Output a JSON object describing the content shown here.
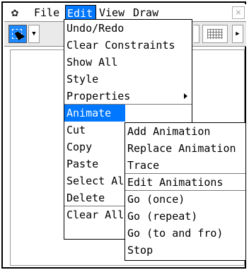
{
  "menubar": {
    "items": [
      {
        "label": "File"
      },
      {
        "label": "Edit"
      },
      {
        "label": "View"
      },
      {
        "label": "Draw"
      }
    ],
    "close": "×"
  },
  "edit_menu": {
    "items": [
      {
        "label": "Undo/Redo"
      },
      {
        "label": "Clear Constraints"
      },
      {
        "label": "Show All"
      },
      {
        "label": "Style"
      },
      {
        "label": "Properties"
      },
      {
        "label": "Animate"
      },
      {
        "label": "Cut"
      },
      {
        "label": "Copy"
      },
      {
        "label": "Paste"
      },
      {
        "label": "Select All"
      },
      {
        "label": "Delete"
      },
      {
        "label": "Clear All"
      }
    ]
  },
  "animate_menu": {
    "items": [
      {
        "label": "Add Animation"
      },
      {
        "label": "Replace Animation"
      },
      {
        "label": "Trace"
      },
      {
        "label": "Edit Animations"
      },
      {
        "label": "Go (once)"
      },
      {
        "label": "Go (repeat)"
      },
      {
        "label": "Go (to and fro)"
      },
      {
        "label": "Stop"
      }
    ]
  },
  "toolbar": {
    "dropdown_glyph": "▼",
    "more_glyph": "▶"
  },
  "colors": {
    "highlight": "#0077ff"
  }
}
